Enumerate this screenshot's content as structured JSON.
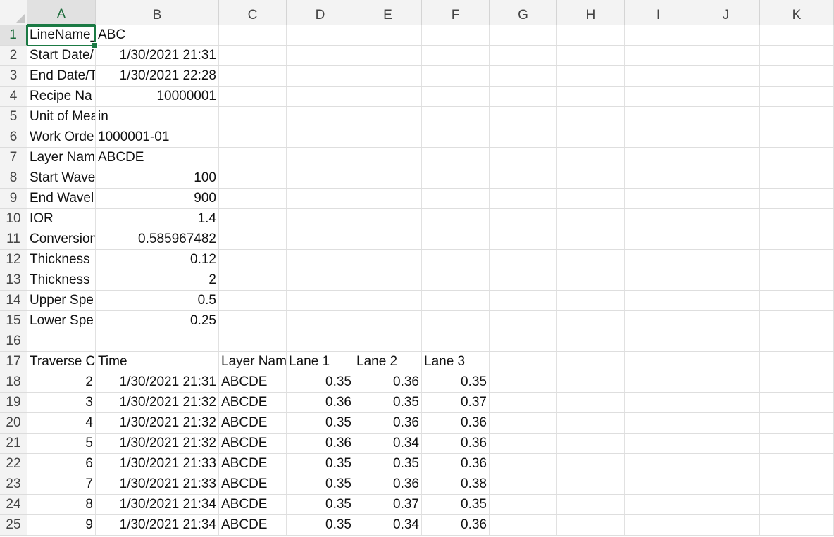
{
  "columns": [
    "A",
    "B",
    "C",
    "D",
    "E",
    "F",
    "G",
    "H",
    "I",
    "J",
    "K"
  ],
  "active_cell": "A1",
  "accent_color": "#1b7a44",
  "rows": [
    {
      "n": "1",
      "cells": [
        {
          "v": "LineName_",
          "t": "txt"
        },
        {
          "v": "ABC",
          "t": "txt"
        }
      ]
    },
    {
      "n": "2",
      "cells": [
        {
          "v": "Start Date/",
          "t": "txt"
        },
        {
          "v": "1/30/2021 21:31",
          "t": "num"
        }
      ]
    },
    {
      "n": "3",
      "cells": [
        {
          "v": "End Date/T",
          "t": "txt"
        },
        {
          "v": "1/30/2021 22:28",
          "t": "num"
        }
      ]
    },
    {
      "n": "4",
      "cells": [
        {
          "v": "Recipe Na",
          "t": "txt"
        },
        {
          "v": "10000001",
          "t": "num"
        }
      ]
    },
    {
      "n": "5",
      "cells": [
        {
          "v": "Unit of Mea",
          "t": "txt"
        },
        {
          "v": "in",
          "t": "txt"
        }
      ]
    },
    {
      "n": "6",
      "cells": [
        {
          "v": "Work Orde",
          "t": "txt"
        },
        {
          "v": "1000001-01",
          "t": "txt"
        }
      ]
    },
    {
      "n": "7",
      "cells": [
        {
          "v": "Layer Nam",
          "t": "txt"
        },
        {
          "v": "ABCDE",
          "t": "txt"
        }
      ]
    },
    {
      "n": "8",
      "cells": [
        {
          "v": "Start Wave",
          "t": "txt"
        },
        {
          "v": "100",
          "t": "num"
        }
      ]
    },
    {
      "n": "9",
      "cells": [
        {
          "v": "End Wavel",
          "t": "txt"
        },
        {
          "v": "900",
          "t": "num"
        }
      ]
    },
    {
      "n": "10",
      "cells": [
        {
          "v": "IOR",
          "t": "txt"
        },
        {
          "v": "1.4",
          "t": "num"
        }
      ]
    },
    {
      "n": "11",
      "cells": [
        {
          "v": "Conversion",
          "t": "txt"
        },
        {
          "v": "0.585967482",
          "t": "num"
        }
      ]
    },
    {
      "n": "12",
      "cells": [
        {
          "v": "Thickness",
          "t": "txt"
        },
        {
          "v": "0.12",
          "t": "num"
        }
      ]
    },
    {
      "n": "13",
      "cells": [
        {
          "v": "Thickness",
          "t": "txt"
        },
        {
          "v": "2",
          "t": "num"
        }
      ]
    },
    {
      "n": "14",
      "cells": [
        {
          "v": "Upper Spe",
          "t": "txt"
        },
        {
          "v": "0.5",
          "t": "num"
        }
      ]
    },
    {
      "n": "15",
      "cells": [
        {
          "v": "Lower Spe",
          "t": "txt"
        },
        {
          "v": "0.25",
          "t": "num"
        }
      ]
    },
    {
      "n": "16",
      "cells": []
    },
    {
      "n": "17",
      "cells": [
        {
          "v": "Traverse C",
          "t": "txt"
        },
        {
          "v": "Time",
          "t": "txt"
        },
        {
          "v": "Layer Nam",
          "t": "txt"
        },
        {
          "v": "Lane 1",
          "t": "txt"
        },
        {
          "v": "Lane 2",
          "t": "txt"
        },
        {
          "v": "Lane 3",
          "t": "txt"
        }
      ]
    },
    {
      "n": "18",
      "cells": [
        {
          "v": "2",
          "t": "num"
        },
        {
          "v": "1/30/2021 21:31",
          "t": "num"
        },
        {
          "v": "ABCDE",
          "t": "txt"
        },
        {
          "v": "0.35",
          "t": "num"
        },
        {
          "v": "0.36",
          "t": "num"
        },
        {
          "v": "0.35",
          "t": "num"
        }
      ]
    },
    {
      "n": "19",
      "cells": [
        {
          "v": "3",
          "t": "num"
        },
        {
          "v": "1/30/2021 21:32",
          "t": "num"
        },
        {
          "v": "ABCDE",
          "t": "txt"
        },
        {
          "v": "0.36",
          "t": "num"
        },
        {
          "v": "0.35",
          "t": "num"
        },
        {
          "v": "0.37",
          "t": "num"
        }
      ]
    },
    {
      "n": "20",
      "cells": [
        {
          "v": "4",
          "t": "num"
        },
        {
          "v": "1/30/2021 21:32",
          "t": "num"
        },
        {
          "v": "ABCDE",
          "t": "txt"
        },
        {
          "v": "0.35",
          "t": "num"
        },
        {
          "v": "0.36",
          "t": "num"
        },
        {
          "v": "0.36",
          "t": "num"
        }
      ]
    },
    {
      "n": "21",
      "cells": [
        {
          "v": "5",
          "t": "num"
        },
        {
          "v": "1/30/2021 21:32",
          "t": "num"
        },
        {
          "v": "ABCDE",
          "t": "txt"
        },
        {
          "v": "0.36",
          "t": "num"
        },
        {
          "v": "0.34",
          "t": "num"
        },
        {
          "v": "0.36",
          "t": "num"
        }
      ]
    },
    {
      "n": "22",
      "cells": [
        {
          "v": "6",
          "t": "num"
        },
        {
          "v": "1/30/2021 21:33",
          "t": "num"
        },
        {
          "v": "ABCDE",
          "t": "txt"
        },
        {
          "v": "0.35",
          "t": "num"
        },
        {
          "v": "0.35",
          "t": "num"
        },
        {
          "v": "0.36",
          "t": "num"
        }
      ]
    },
    {
      "n": "23",
      "cells": [
        {
          "v": "7",
          "t": "num"
        },
        {
          "v": "1/30/2021 21:33",
          "t": "num"
        },
        {
          "v": "ABCDE",
          "t": "txt"
        },
        {
          "v": "0.35",
          "t": "num"
        },
        {
          "v": "0.36",
          "t": "num"
        },
        {
          "v": "0.38",
          "t": "num"
        }
      ]
    },
    {
      "n": "24",
      "cells": [
        {
          "v": "8",
          "t": "num"
        },
        {
          "v": "1/30/2021 21:34",
          "t": "num"
        },
        {
          "v": "ABCDE",
          "t": "txt"
        },
        {
          "v": "0.35",
          "t": "num"
        },
        {
          "v": "0.37",
          "t": "num"
        },
        {
          "v": "0.35",
          "t": "num"
        }
      ]
    },
    {
      "n": "25",
      "cells": [
        {
          "v": "9",
          "t": "num"
        },
        {
          "v": "1/30/2021 21:34",
          "t": "num"
        },
        {
          "v": "ABCDE",
          "t": "txt"
        },
        {
          "v": "0.35",
          "t": "num"
        },
        {
          "v": "0.34",
          "t": "num"
        },
        {
          "v": "0.36",
          "t": "num"
        }
      ]
    }
  ]
}
